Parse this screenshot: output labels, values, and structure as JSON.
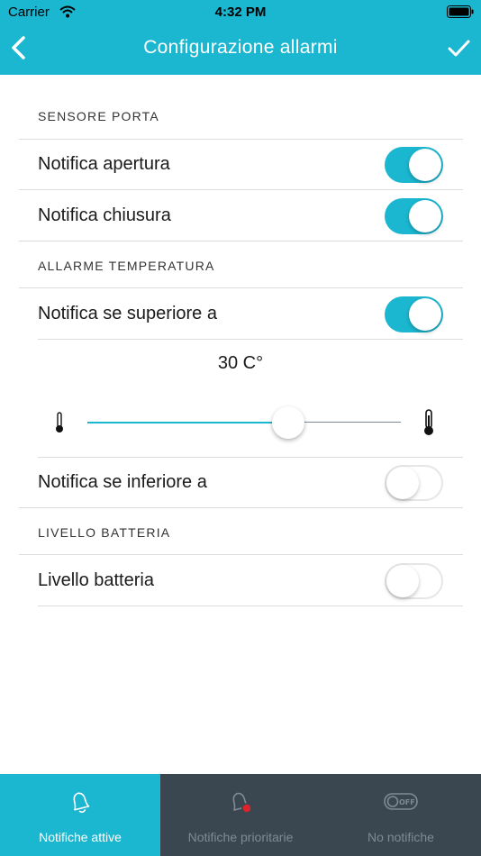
{
  "status_bar": {
    "carrier": "Carrier",
    "time": "4:32 PM"
  },
  "nav": {
    "title": "Configurazione allarmi",
    "back_icon": "chevron-left-icon",
    "done_icon": "checkmark-icon"
  },
  "sections": {
    "door": {
      "header": "SENSORE PORTA",
      "rows": [
        {
          "label": "Notifica apertura",
          "enabled": true
        },
        {
          "label": "Notifica chiusura",
          "enabled": true
        }
      ]
    },
    "temperature": {
      "header": "ALLARME TEMPERATURA",
      "above_label": "Notifica se superiore a",
      "above_enabled": true,
      "value_display": "30 C°",
      "slider_fraction": 0.64,
      "below_label": "Notifica se inferiore a",
      "below_enabled": false
    },
    "battery": {
      "header": "LIVELLO BATTERIA",
      "rows": [
        {
          "label": "Livello batteria",
          "enabled": false
        }
      ]
    }
  },
  "tabs": [
    {
      "label": "Notifiche attive",
      "icon": "bell-icon",
      "active": true
    },
    {
      "label": "Notifiche prioritarie",
      "icon": "bell-alert-icon",
      "active": false
    },
    {
      "label": "No notifiche",
      "icon": "off-switch-icon",
      "active": false
    }
  ],
  "colors": {
    "accent": "#1bb6cf",
    "tabbar": "#3a4750",
    "alert_dot": "#e0222b"
  }
}
